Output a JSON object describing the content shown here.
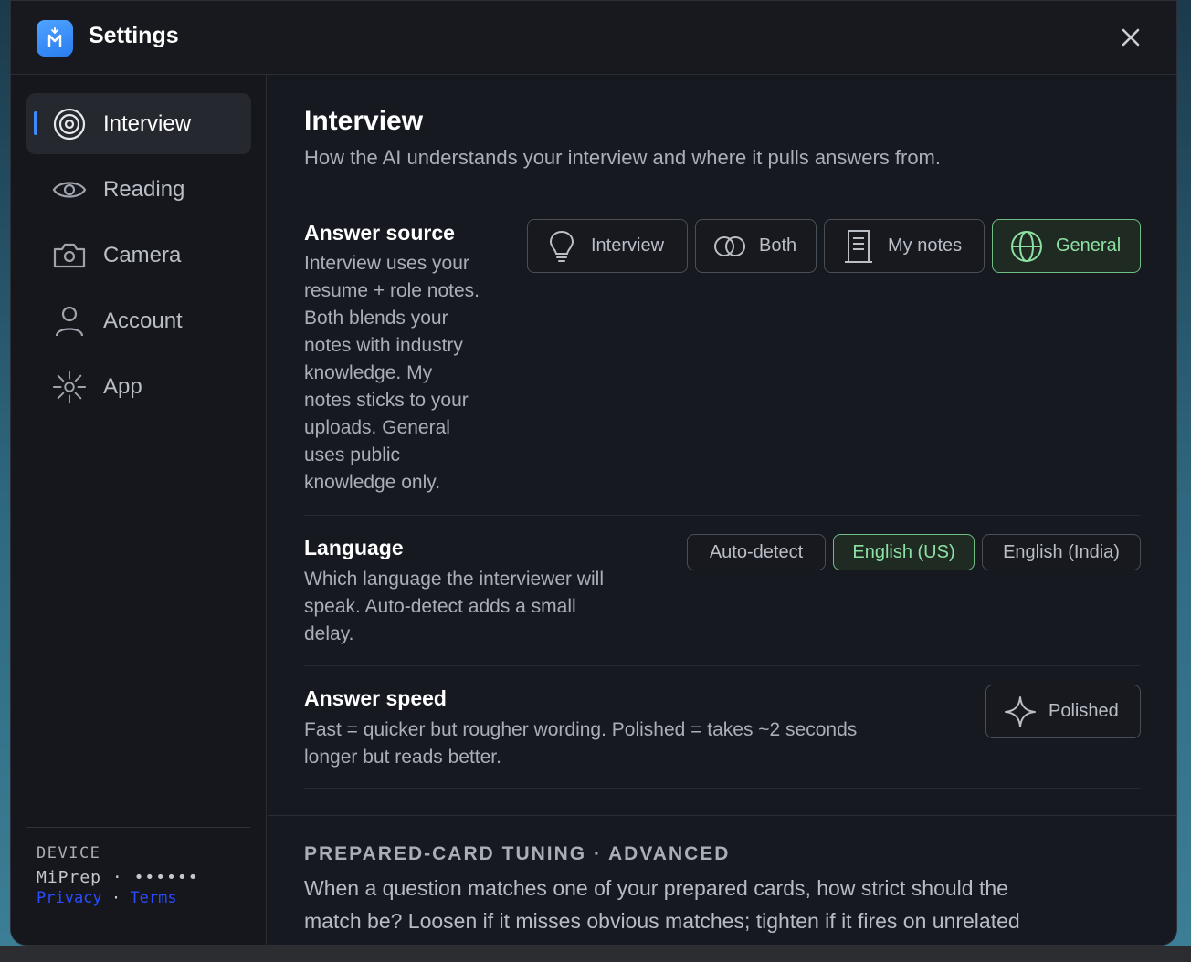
{
  "window": {
    "title": "Settings",
    "logo_letter": "M"
  },
  "sidebar": {
    "items": [
      {
        "label": "Interview",
        "icon": "target-icon",
        "active": true
      },
      {
        "label": "Reading",
        "icon": "eye-icon",
        "active": false
      },
      {
        "label": "Camera",
        "icon": "camera-icon",
        "active": false
      },
      {
        "label": "Account",
        "icon": "user-icon",
        "active": false
      },
      {
        "label": "App",
        "icon": "sun-icon",
        "active": false
      }
    ],
    "footer": {
      "heading": "DEVICE",
      "device_name": "MiPrep",
      "separator": "·",
      "device_id_masked": "••••••",
      "privacy_link": "Privacy",
      "link_separator": "·",
      "terms_link": "Terms"
    }
  },
  "content": {
    "title": "Interview",
    "subtitle": "How the AI understands your interview and where it pulls answers from.",
    "answer_source": {
      "label": "Answer source",
      "description_lines": [
        "Interview uses your",
        "resume + role notes.",
        "Both blends your",
        "notes with industry",
        "knowledge. My",
        "notes sticks to your",
        "uploads. General",
        "uses public",
        "knowledge only."
      ],
      "options": [
        {
          "label": "Interview",
          "icon": "lightbulb-icon",
          "selected": false
        },
        {
          "label": "Both",
          "icon": "overlap-circles-icon",
          "selected": false
        },
        {
          "label": "My notes",
          "icon": "document-icon",
          "selected": false
        },
        {
          "label": "General",
          "icon": "globe-icon",
          "selected": true
        }
      ]
    },
    "language": {
      "label": "Language",
      "description_lines": [
        "Which language the interviewer will",
        "speak. Auto-detect adds a small",
        "delay."
      ],
      "options": [
        {
          "label": "Auto-detect",
          "selected": false
        },
        {
          "label": "English (US)",
          "selected": true
        },
        {
          "label": "English (India)",
          "selected": false
        }
      ]
    },
    "answer_speed": {
      "label": "Answer speed",
      "description_lines": [
        "Fast = quicker but rougher wording. Polished = takes ~2 seconds",
        "longer but reads better."
      ],
      "option": {
        "label": "Polished",
        "icon": "sparkle-icon"
      }
    },
    "advanced": {
      "heading": "PREPARED-CARD TUNING · ADVANCED",
      "description_lines": [
        "When a question matches one of your prepared cards, how strict should the",
        "match be? Loosen if it misses obvious matches; tighten if it fires on unrelated"
      ]
    }
  },
  "colors": {
    "accent_blue": "#3d8bff",
    "selected_green": "#8de0a2",
    "link_blue": "#2b4cff"
  }
}
